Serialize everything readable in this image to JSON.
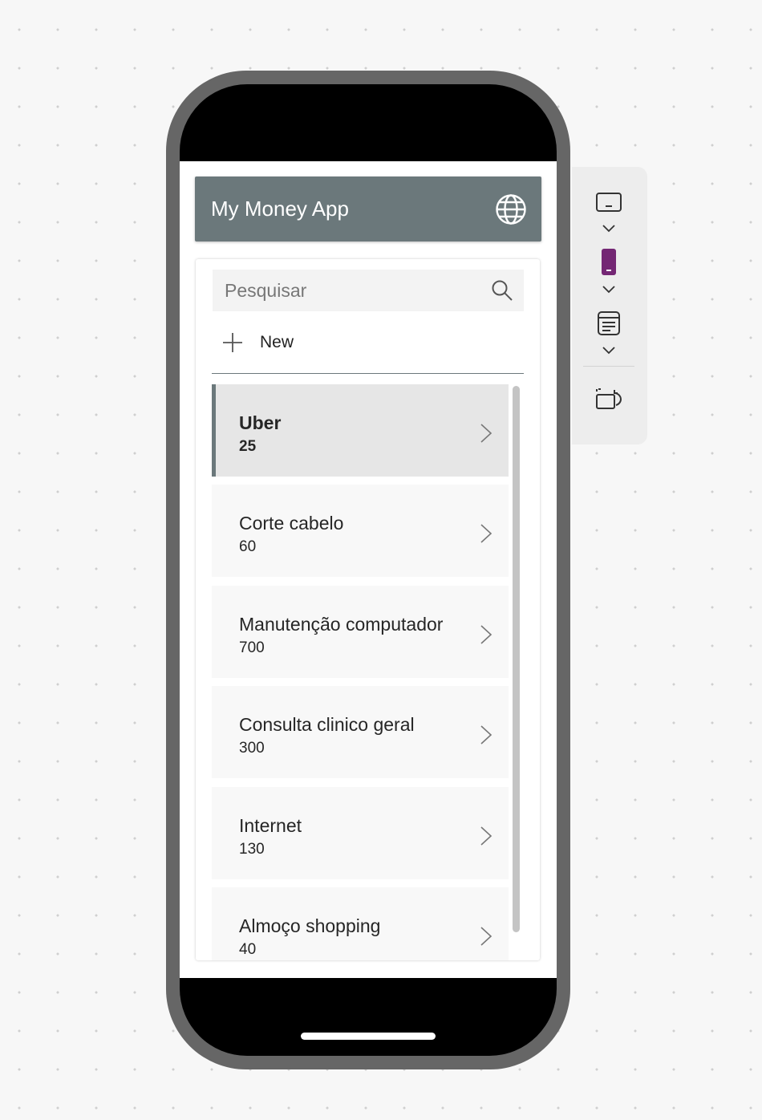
{
  "app": {
    "title": "My Money App"
  },
  "search": {
    "placeholder": "Pesquisar",
    "value": ""
  },
  "actions": {
    "new_label": "New"
  },
  "items": [
    {
      "title": "Uber",
      "value": "25",
      "selected": true
    },
    {
      "title": "Corte cabelo",
      "value": "60",
      "selected": false
    },
    {
      "title": "Manutenção computador",
      "value": "700",
      "selected": false
    },
    {
      "title": "Consulta clinico geral",
      "value": "300",
      "selected": false
    },
    {
      "title": "Internet",
      "value": "130",
      "selected": false
    },
    {
      "title": "Almoço shopping",
      "value": "40",
      "selected": false
    }
  ],
  "toolbar": {
    "buttons": [
      "tablet-view-icon",
      "phone-view-icon",
      "web-layout-icon",
      "rotate-device-icon"
    ],
    "active": "phone-view-icon"
  },
  "colors": {
    "header": "#6b787b",
    "accent": "#742774",
    "selected_row": "#e6e6e6",
    "row": "#f8f8f8",
    "device_frame": "#666666"
  }
}
